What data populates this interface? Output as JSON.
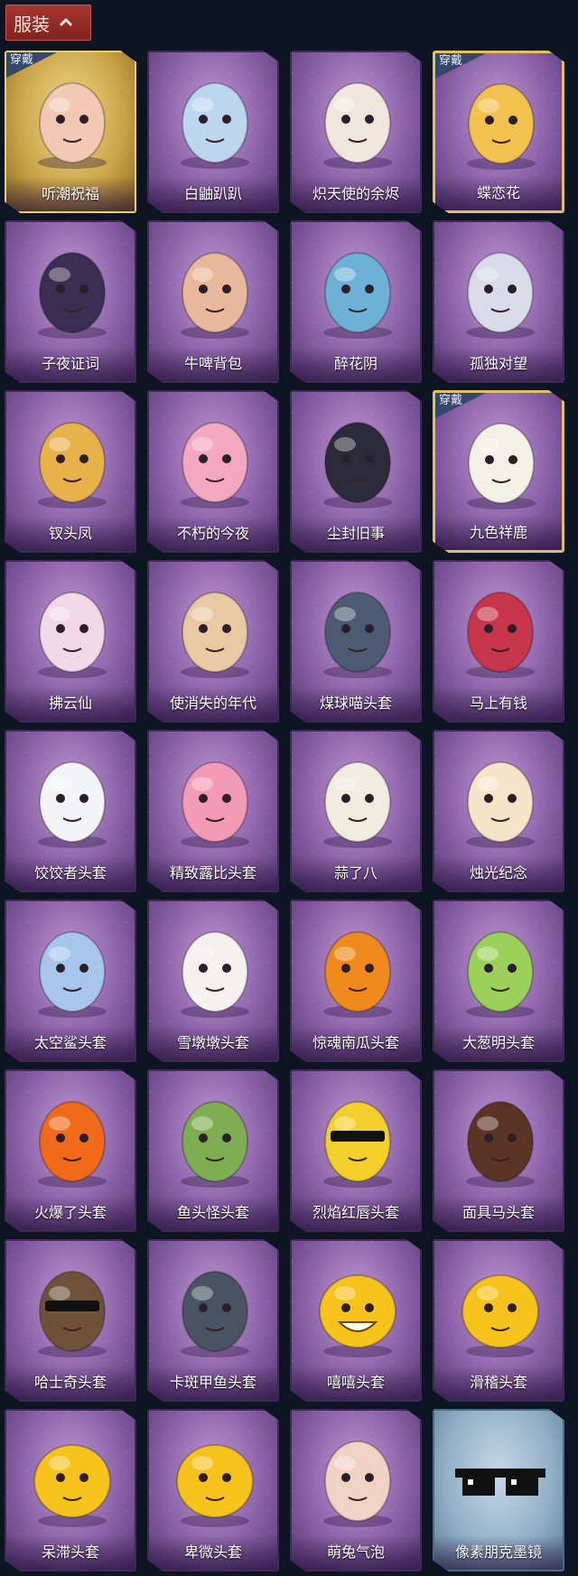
{
  "header": {
    "title": "服装"
  },
  "badge_text": "穿戴",
  "items": [
    {
      "name": "听潮祝福",
      "equipped": true,
      "style": "gold",
      "icon": "white-figure-with-blue-wings-icon",
      "color": "#f1c9b4"
    },
    {
      "name": "白鼬趴趴",
      "equipped": false,
      "style": "purple",
      "icon": "white-ermine-icon",
      "color": "#bcd6ee"
    },
    {
      "name": "炽天使的余烬",
      "equipped": false,
      "style": "purple",
      "icon": "angel-doll-icon",
      "color": "#f0e6dc"
    },
    {
      "name": "蝶恋花",
      "equipped": true,
      "style": "gold2",
      "icon": "flower-wreath-icon",
      "color": "#f2c14e"
    },
    {
      "name": "子夜证词",
      "equipped": false,
      "style": "purple",
      "icon": "plague-doctor-doll-icon",
      "color": "#3a2f52"
    },
    {
      "name": "牛啤背包",
      "equipped": false,
      "style": "purple",
      "icon": "cow-in-barrel-icon",
      "color": "#e7b89c"
    },
    {
      "name": "醉花阴",
      "equipped": false,
      "style": "purple",
      "icon": "dreamcatcher-icon",
      "color": "#6db2d6"
    },
    {
      "name": "孤独对望",
      "equipped": false,
      "style": "purple",
      "icon": "white-haired-doll-icon",
      "color": "#d9dbe8"
    },
    {
      "name": "钗头凤",
      "equipped": false,
      "style": "purple",
      "icon": "phoenix-crown-doll-icon",
      "color": "#e7b24a"
    },
    {
      "name": "不朽的今夜",
      "equipped": false,
      "style": "purple",
      "icon": "pink-fox-icon",
      "color": "#f4a7c0"
    },
    {
      "name": "尘封旧事",
      "equipped": false,
      "style": "purple",
      "icon": "dark-suit-doll-icon",
      "color": "#2b2b3a"
    },
    {
      "name": "九色祥鹿",
      "equipped": true,
      "style": "gold2",
      "icon": "white-deer-icon",
      "color": "#f3f0e6"
    },
    {
      "name": "拂云仙",
      "equipped": false,
      "style": "purple",
      "icon": "fairy-doll-icon",
      "color": "#f3d8e8"
    },
    {
      "name": "使消失的年代",
      "equipped": false,
      "style": "purple",
      "icon": "sleeping-girl-doll-icon",
      "color": "#e8c9a4"
    },
    {
      "name": "煤球喵头套",
      "equipped": false,
      "style": "purple",
      "icon": "gray-cat-head-icon",
      "color": "#4d5a74"
    },
    {
      "name": "马上有钱",
      "equipped": false,
      "style": "purple",
      "icon": "red-horse-head-icon",
      "color": "#c8364c"
    },
    {
      "name": "饺饺者头套",
      "equipped": false,
      "style": "purple",
      "icon": "dumpling-head-icon",
      "color": "#f3f4f6"
    },
    {
      "name": "精致露比头套",
      "equipped": false,
      "style": "purple",
      "icon": "pink-beaver-head-icon",
      "color": "#f29ab6"
    },
    {
      "name": "蒜了八",
      "equipped": false,
      "style": "purple",
      "icon": "garlic-head-icon",
      "color": "#f1ece0"
    },
    {
      "name": "烛光纪念",
      "equipped": false,
      "style": "purple",
      "icon": "candle-head-icon",
      "color": "#f6e4c8"
    },
    {
      "name": "太空鲨头套",
      "equipped": false,
      "style": "purple",
      "icon": "shark-head-icon",
      "color": "#a8c6ec"
    },
    {
      "name": "雪墩墩头套",
      "equipped": false,
      "style": "purple",
      "icon": "snowman-head-icon",
      "color": "#f5f1ee"
    },
    {
      "name": "惊魂南瓜头套",
      "equipped": false,
      "style": "purple",
      "icon": "pumpkin-head-icon",
      "color": "#f08a1c"
    },
    {
      "name": "大葱明头套",
      "equipped": false,
      "style": "purple",
      "icon": "scallion-head-icon",
      "color": "#9bd15a"
    },
    {
      "name": "火爆了头套",
      "equipped": false,
      "style": "purple",
      "icon": "fire-head-icon",
      "color": "#f06a1a"
    },
    {
      "name": "鱼头怪头套",
      "equipped": false,
      "style": "purple",
      "icon": "fish-head-icon",
      "color": "#7fae52"
    },
    {
      "name": "烈焰红唇头套",
      "equipped": false,
      "style": "purple",
      "icon": "yellow-lips-head-icon",
      "color": "#f3cf2c"
    },
    {
      "name": "面具马头套",
      "equipped": false,
      "style": "purple",
      "icon": "horse-mask-icon",
      "color": "#5b3426"
    },
    {
      "name": "哈士奇头套",
      "equipped": false,
      "style": "purple",
      "icon": "dog-head-sunglasses-icon",
      "color": "#6e5138"
    },
    {
      "name": "卡斑甲鱼头套",
      "equipped": false,
      "style": "purple",
      "icon": "whale-head-icon",
      "color": "#495362"
    },
    {
      "name": "嘻嘻头套",
      "equipped": false,
      "style": "purple",
      "icon": "grin-emoji-icon",
      "color": "#f6c21c"
    },
    {
      "name": "滑稽头套",
      "equipped": false,
      "style": "purple",
      "icon": "smirk-emoji-icon",
      "color": "#f6c21c"
    },
    {
      "name": "呆滞头套",
      "equipped": false,
      "style": "purple",
      "icon": "stare-emoji-icon",
      "color": "#f6c21c"
    },
    {
      "name": "卑微头套",
      "equipped": false,
      "style": "purple",
      "icon": "timid-emoji-icon",
      "color": "#f6c21c"
    },
    {
      "name": "萌兔气泡",
      "equipped": false,
      "style": "purple",
      "icon": "bald-figure-icon",
      "color": "#f1d3c6"
    },
    {
      "name": "像素朋克墨镜",
      "equipped": false,
      "style": "blue",
      "icon": "pixel-sunglasses-icon",
      "color": "#111111"
    }
  ]
}
